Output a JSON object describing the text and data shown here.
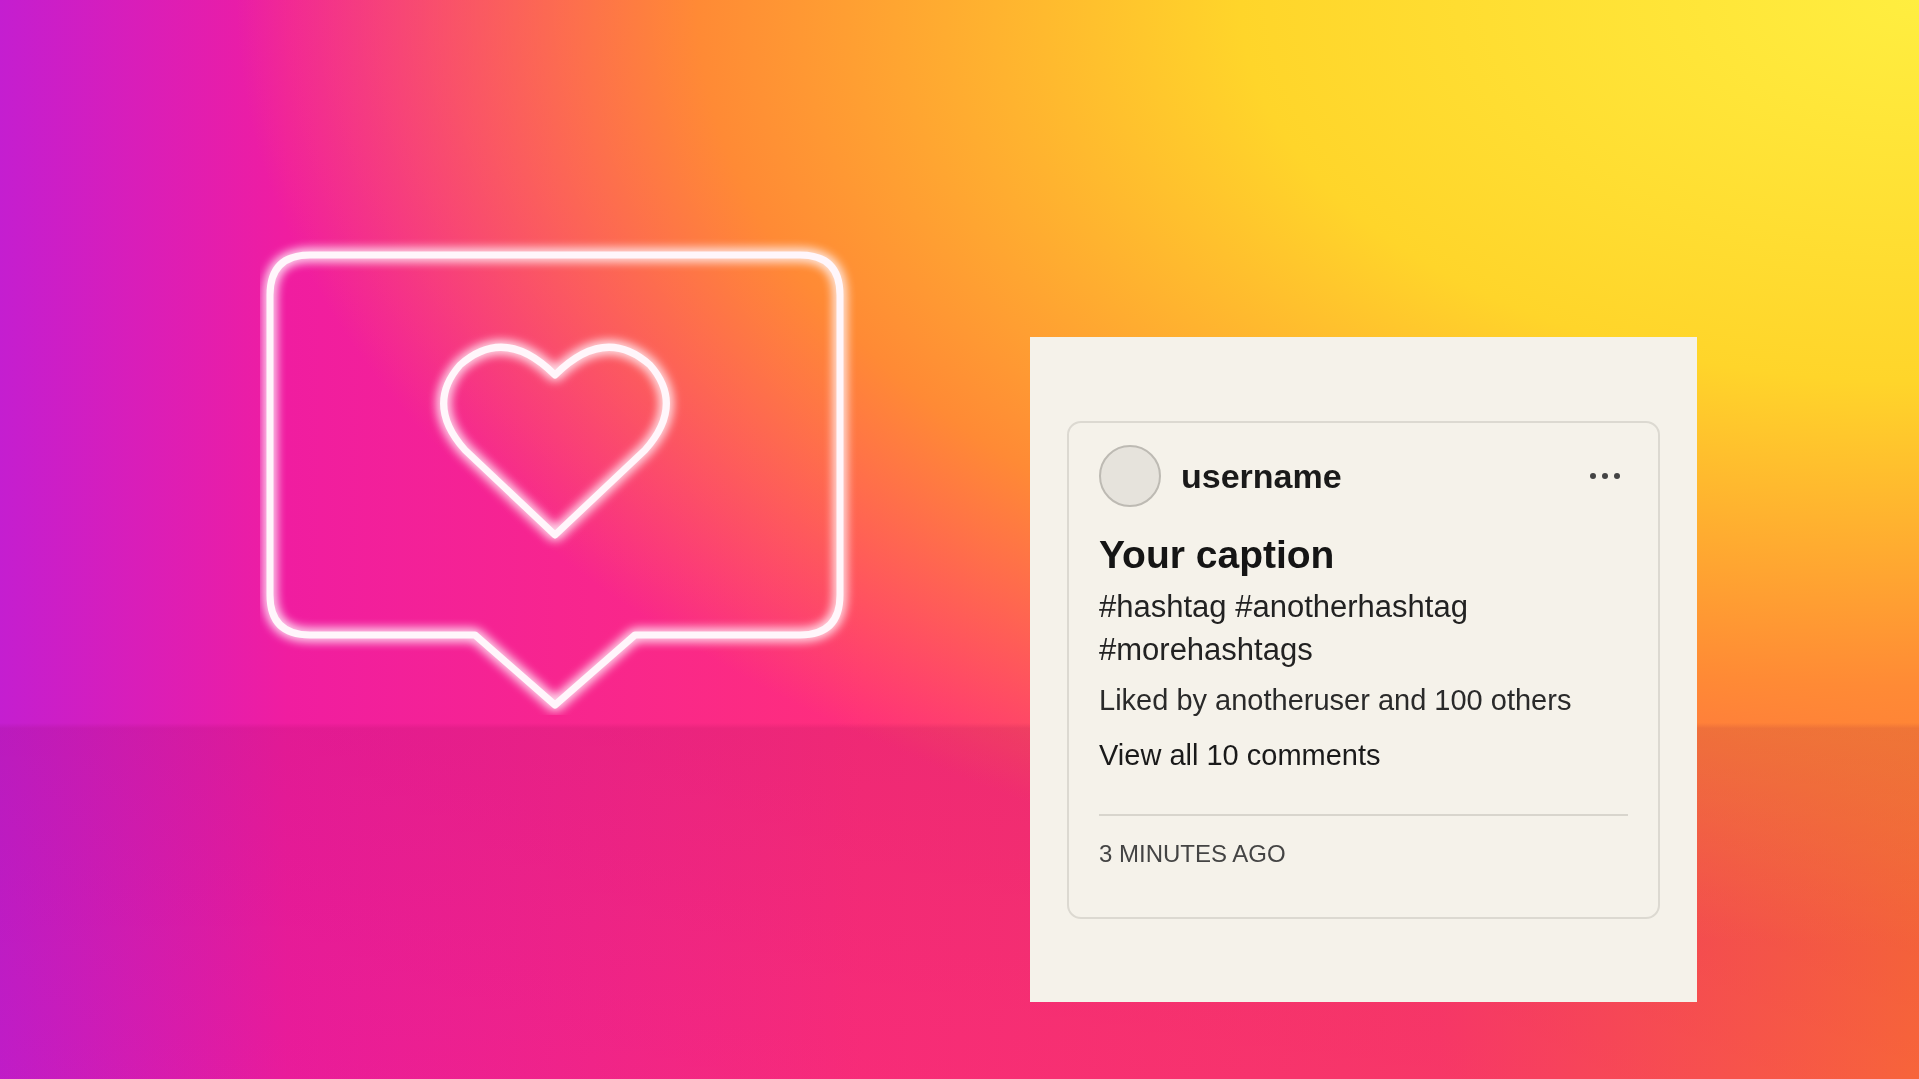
{
  "post": {
    "username": "username",
    "caption": "Your caption",
    "hashtags": "#hashtag #anotherhashtag #morehashtags",
    "likes": "Liked by anotheruser and 100 others",
    "comments_link": "View all 10 comments",
    "timestamp": "3 MINUTES AGO"
  }
}
